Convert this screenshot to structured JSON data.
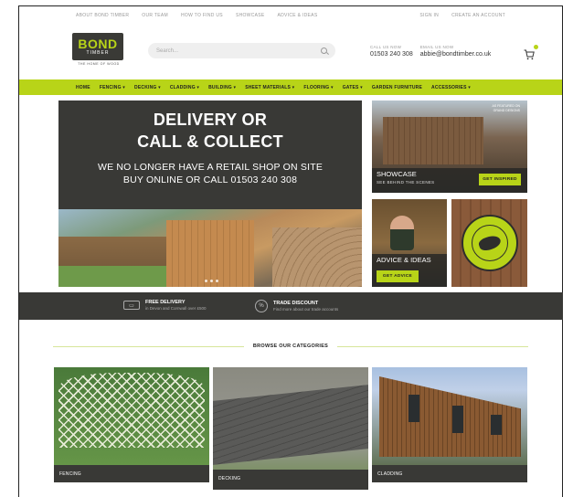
{
  "util": {
    "left": [
      "ABOUT BOND TIMBER",
      "OUR TEAM",
      "HOW TO FIND US",
      "SHOWCASE",
      "ADVICE & IDEAS"
    ],
    "right": [
      "SIGN IN",
      "CREATE AN ACCOUNT"
    ]
  },
  "logo": {
    "word": "BOND",
    "sub": "TIMBER",
    "tagline": "THE HOME OF WOOD"
  },
  "search": {
    "placeholder": "Search..."
  },
  "contact": {
    "call_label": "CALL US NOW",
    "call_value": "01503 240 308",
    "email_label": "EMAIL US NOW",
    "email_value": "abbie@bondtimber.co.uk"
  },
  "nav": [
    {
      "label": "HOME",
      "chev": false
    },
    {
      "label": "FENCING",
      "chev": true
    },
    {
      "label": "DECKING",
      "chev": true
    },
    {
      "label": "CLADDING",
      "chev": true
    },
    {
      "label": "BUILDING",
      "chev": true
    },
    {
      "label": "SHEET MATERIALS",
      "chev": true
    },
    {
      "label": "FLOORING",
      "chev": true
    },
    {
      "label": "GATES",
      "chev": true
    },
    {
      "label": "GARDEN FURNITURE",
      "chev": false
    },
    {
      "label": "ACCESSORIES",
      "chev": true
    }
  ],
  "hero": {
    "line1": "DELIVERY OR",
    "line2": "CALL & COLLECT",
    "line3": "WE NO LONGER HAVE A RETAIL SHOP ON SITE",
    "line4": "BUY ONLINE OR CALL 01503 240 308"
  },
  "showcase": {
    "title": "SHOWCASE",
    "sub": "SEE BEHIND THE SCENES",
    "badge1": "AS FEATURED ON",
    "badge2": "GRAND DESIGNS",
    "button": "GET INSPIRED"
  },
  "advice": {
    "title": "ADVICE & IDEAS",
    "button": "GET ADVICE"
  },
  "strip": {
    "delivery_title": "FREE DELIVERY",
    "delivery_sub": "in Devon and Cornwall over £500",
    "trade_title": "TRADE DISCOUNT",
    "trade_sub": "Find more about our trade accounts"
  },
  "browse": {
    "label": "BROWSE OUR CATEGORIES"
  },
  "categories": [
    {
      "label": "FENCING"
    },
    {
      "label": "DECKING"
    },
    {
      "label": "CLADDING"
    }
  ],
  "colors": {
    "accent": "#b8d418",
    "dark": "#393936"
  }
}
